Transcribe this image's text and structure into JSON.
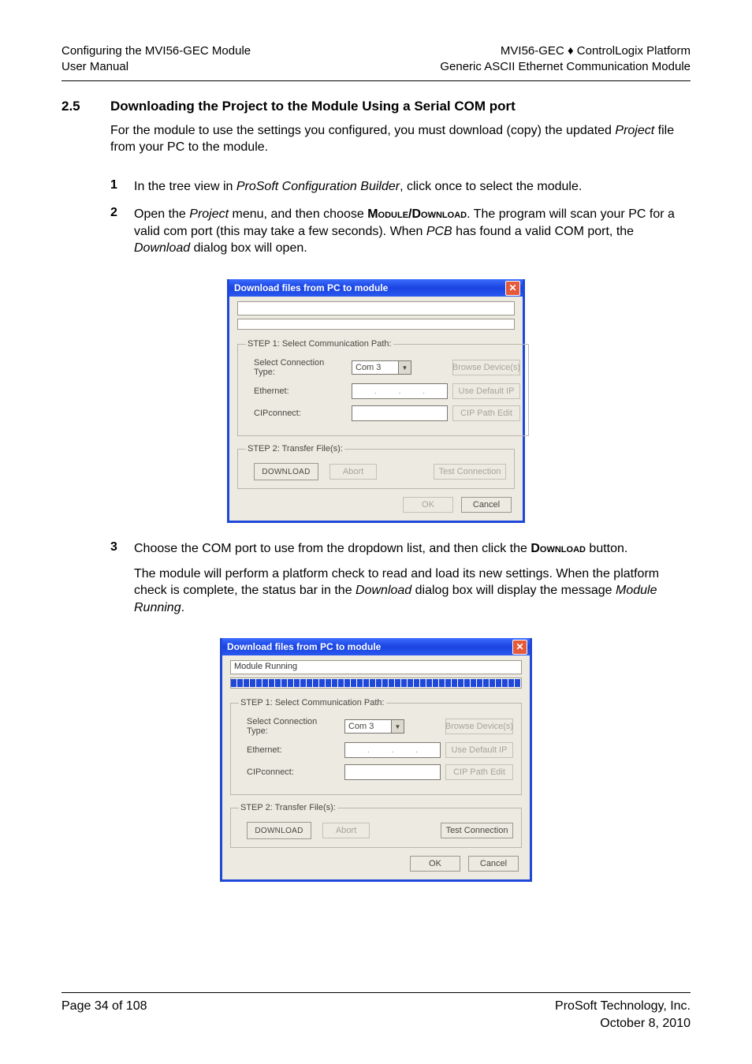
{
  "header": {
    "left_line1": "Configuring the MVI56-GEC Module",
    "left_line2": "User Manual",
    "right_line1": "MVI56-GEC ♦ ControlLogix Platform",
    "right_line2": "Generic ASCII Ethernet Communication Module"
  },
  "section": {
    "number": "2.5",
    "title": "Downloading the Project to the Module Using a Serial COM port",
    "intro_a": "For the module to use the settings you configured, you must download (copy) the updated ",
    "intro_b_italic": "Project",
    "intro_c": " file from your PC to the module."
  },
  "steps": {
    "li1_num": "1",
    "li1_a": "In the tree view in ",
    "li1_b_italic": "ProSoft Configuration Builder",
    "li1_c": ", click once to select the module.",
    "li2_num": "2",
    "li2_a": "Open the ",
    "li2_b_italic": "Project",
    "li2_c": " menu, and then choose ",
    "li2_d_sc": "Module/Download",
    "li2_e": ". The program will scan your PC for a valid com port (this may take a few seconds). When ",
    "li2_f_italic": "PCB",
    "li2_g": " has found a valid COM port, the ",
    "li2_h_italic": "Download",
    "li2_i": " dialog box will open.",
    "li3_num": "3",
    "li3_a": "Choose the COM port to use from the dropdown list, and then click the ",
    "li3_b_sc": "Download",
    "li3_c": " button.",
    "li3_p2_a": "The module will perform a platform check to read and load its new settings. When the platform check is complete, the status bar in the ",
    "li3_p2_b_italic": "Download",
    "li3_p2_c": " dialog box will display the message ",
    "li3_p2_d_italic": "Module Running",
    "li3_p2_e": "."
  },
  "dialog1": {
    "title": "Download files from PC to module",
    "status": "",
    "progress_pct": 0,
    "step1_legend": "STEP 1: Select Communication Path:",
    "conn_type_label": "Select Connection Type:",
    "conn_type_value": "Com 3",
    "browse_btn": "Browse Device(s)",
    "ethernet_label": "Ethernet:",
    "default_ip_btn": "Use Default IP",
    "cip_label": "CIPconnect:",
    "cip_btn": "CIP Path Edit",
    "step2_legend": "STEP 2: Transfer File(s):",
    "download_btn": "DOWNLOAD",
    "abort_btn": "Abort",
    "test_btn": "Test Connection",
    "ok_btn": "OK",
    "cancel_btn": "Cancel"
  },
  "dialog2": {
    "title": "Download files from PC to module",
    "status": "Module Running",
    "progress_pct": 100,
    "step1_legend": "STEP 1: Select Communication Path:",
    "conn_type_label": "Select Connection Type:",
    "conn_type_value": "Com 3",
    "browse_btn": "Browse Device(s)",
    "ethernet_label": "Ethernet:",
    "default_ip_btn": "Use Default IP",
    "cip_label": "CIPconnect:",
    "cip_btn": "CIP Path Edit",
    "step2_legend": "STEP 2: Transfer File(s):",
    "download_btn": "DOWNLOAD",
    "abort_btn": "Abort",
    "test_btn": "Test Connection",
    "ok_btn": "OK",
    "cancel_btn": "Cancel"
  },
  "footer": {
    "left": "Page 34 of 108",
    "right_line1": "ProSoft Technology, Inc.",
    "right_line2": "October 8, 2010"
  }
}
